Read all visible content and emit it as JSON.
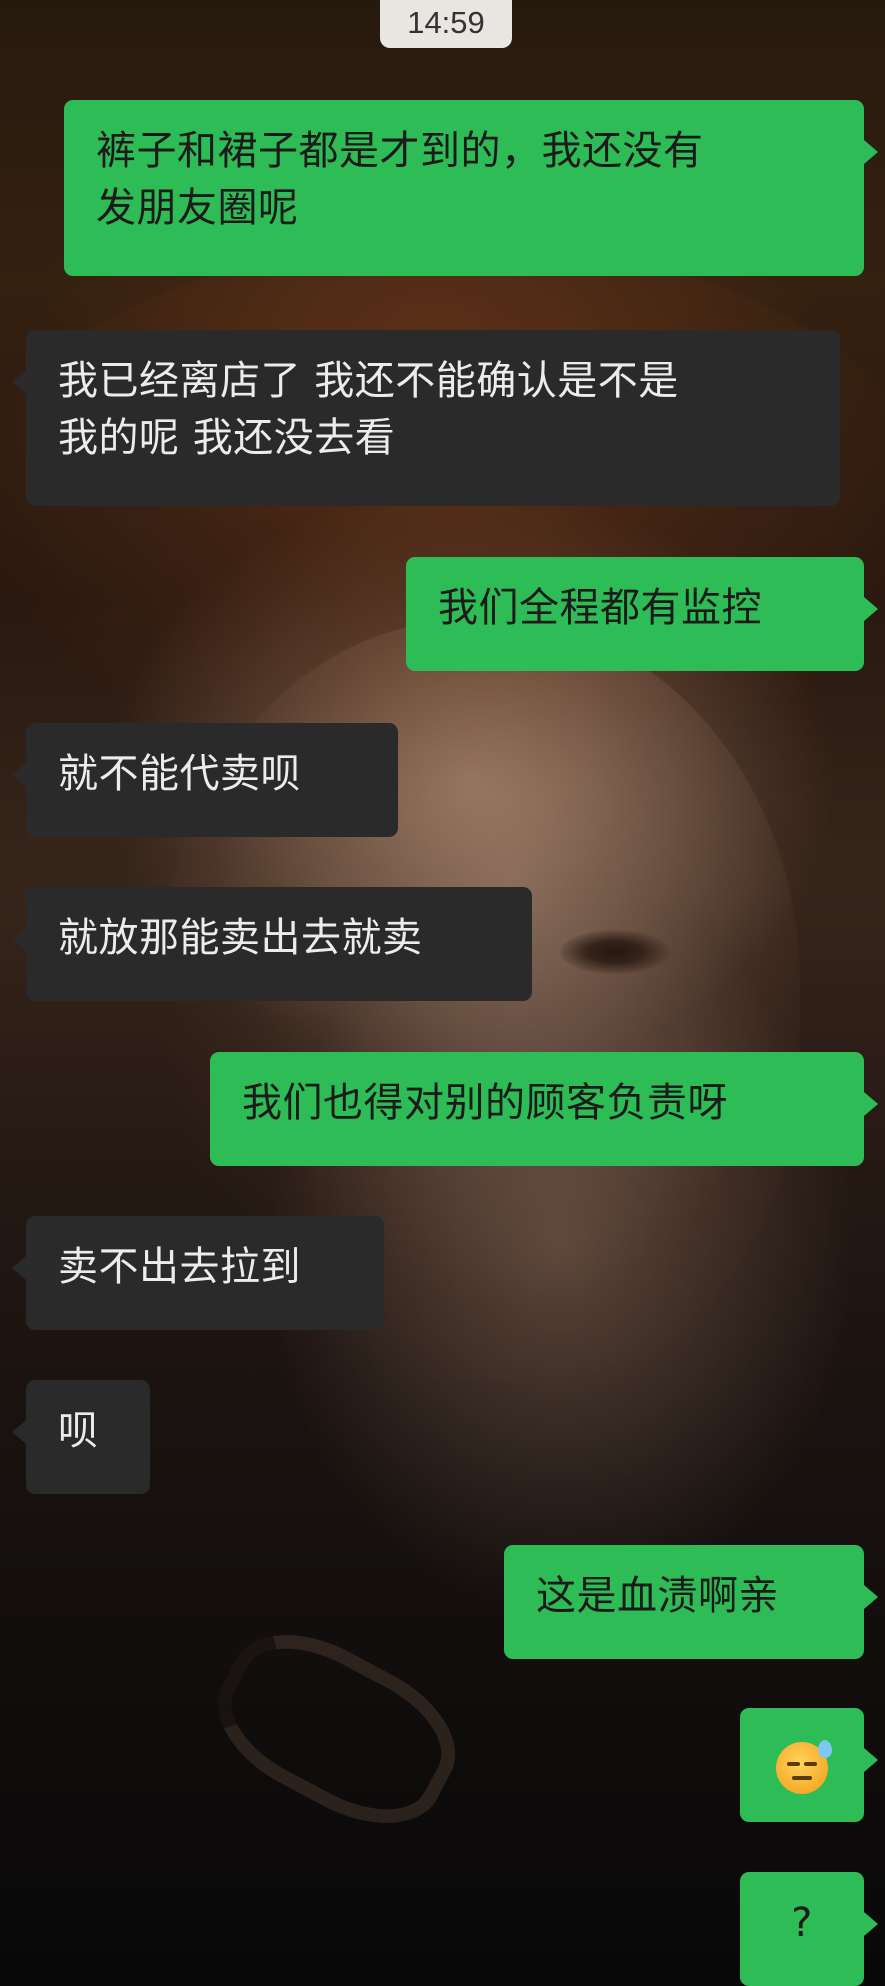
{
  "status": {
    "time": "14:59"
  },
  "messages": [
    {
      "side": "out",
      "lines": [
        "裤子和裙子都是才到的，我还没有",
        "发朋友圈呢"
      ]
    },
    {
      "side": "in",
      "lines": [
        "我已经离店了 我还不能确认是不是",
        "我的呢 我还没去看"
      ]
    },
    {
      "side": "out",
      "lines": [
        "我们全程都有监控"
      ]
    },
    {
      "side": "in",
      "lines": [
        "就不能代卖呗"
      ]
    },
    {
      "side": "in",
      "lines": [
        "就放那能卖出去就卖"
      ]
    },
    {
      "side": "out",
      "lines": [
        "我们也得对别的顾客负责呀"
      ]
    },
    {
      "side": "in",
      "lines": [
        "卖不出去拉到"
      ]
    },
    {
      "side": "in",
      "lines": [
        "呗"
      ]
    },
    {
      "side": "out",
      "lines": [
        "这是血渍啊亲"
      ]
    },
    {
      "side": "out",
      "emoji": "sweat-face-emoji"
    },
    {
      "side": "out",
      "lines": [
        "?"
      ]
    }
  ],
  "colors": {
    "outgoing_bubble": "#2ebc56",
    "incoming_bubble": "#2a2a2a"
  }
}
